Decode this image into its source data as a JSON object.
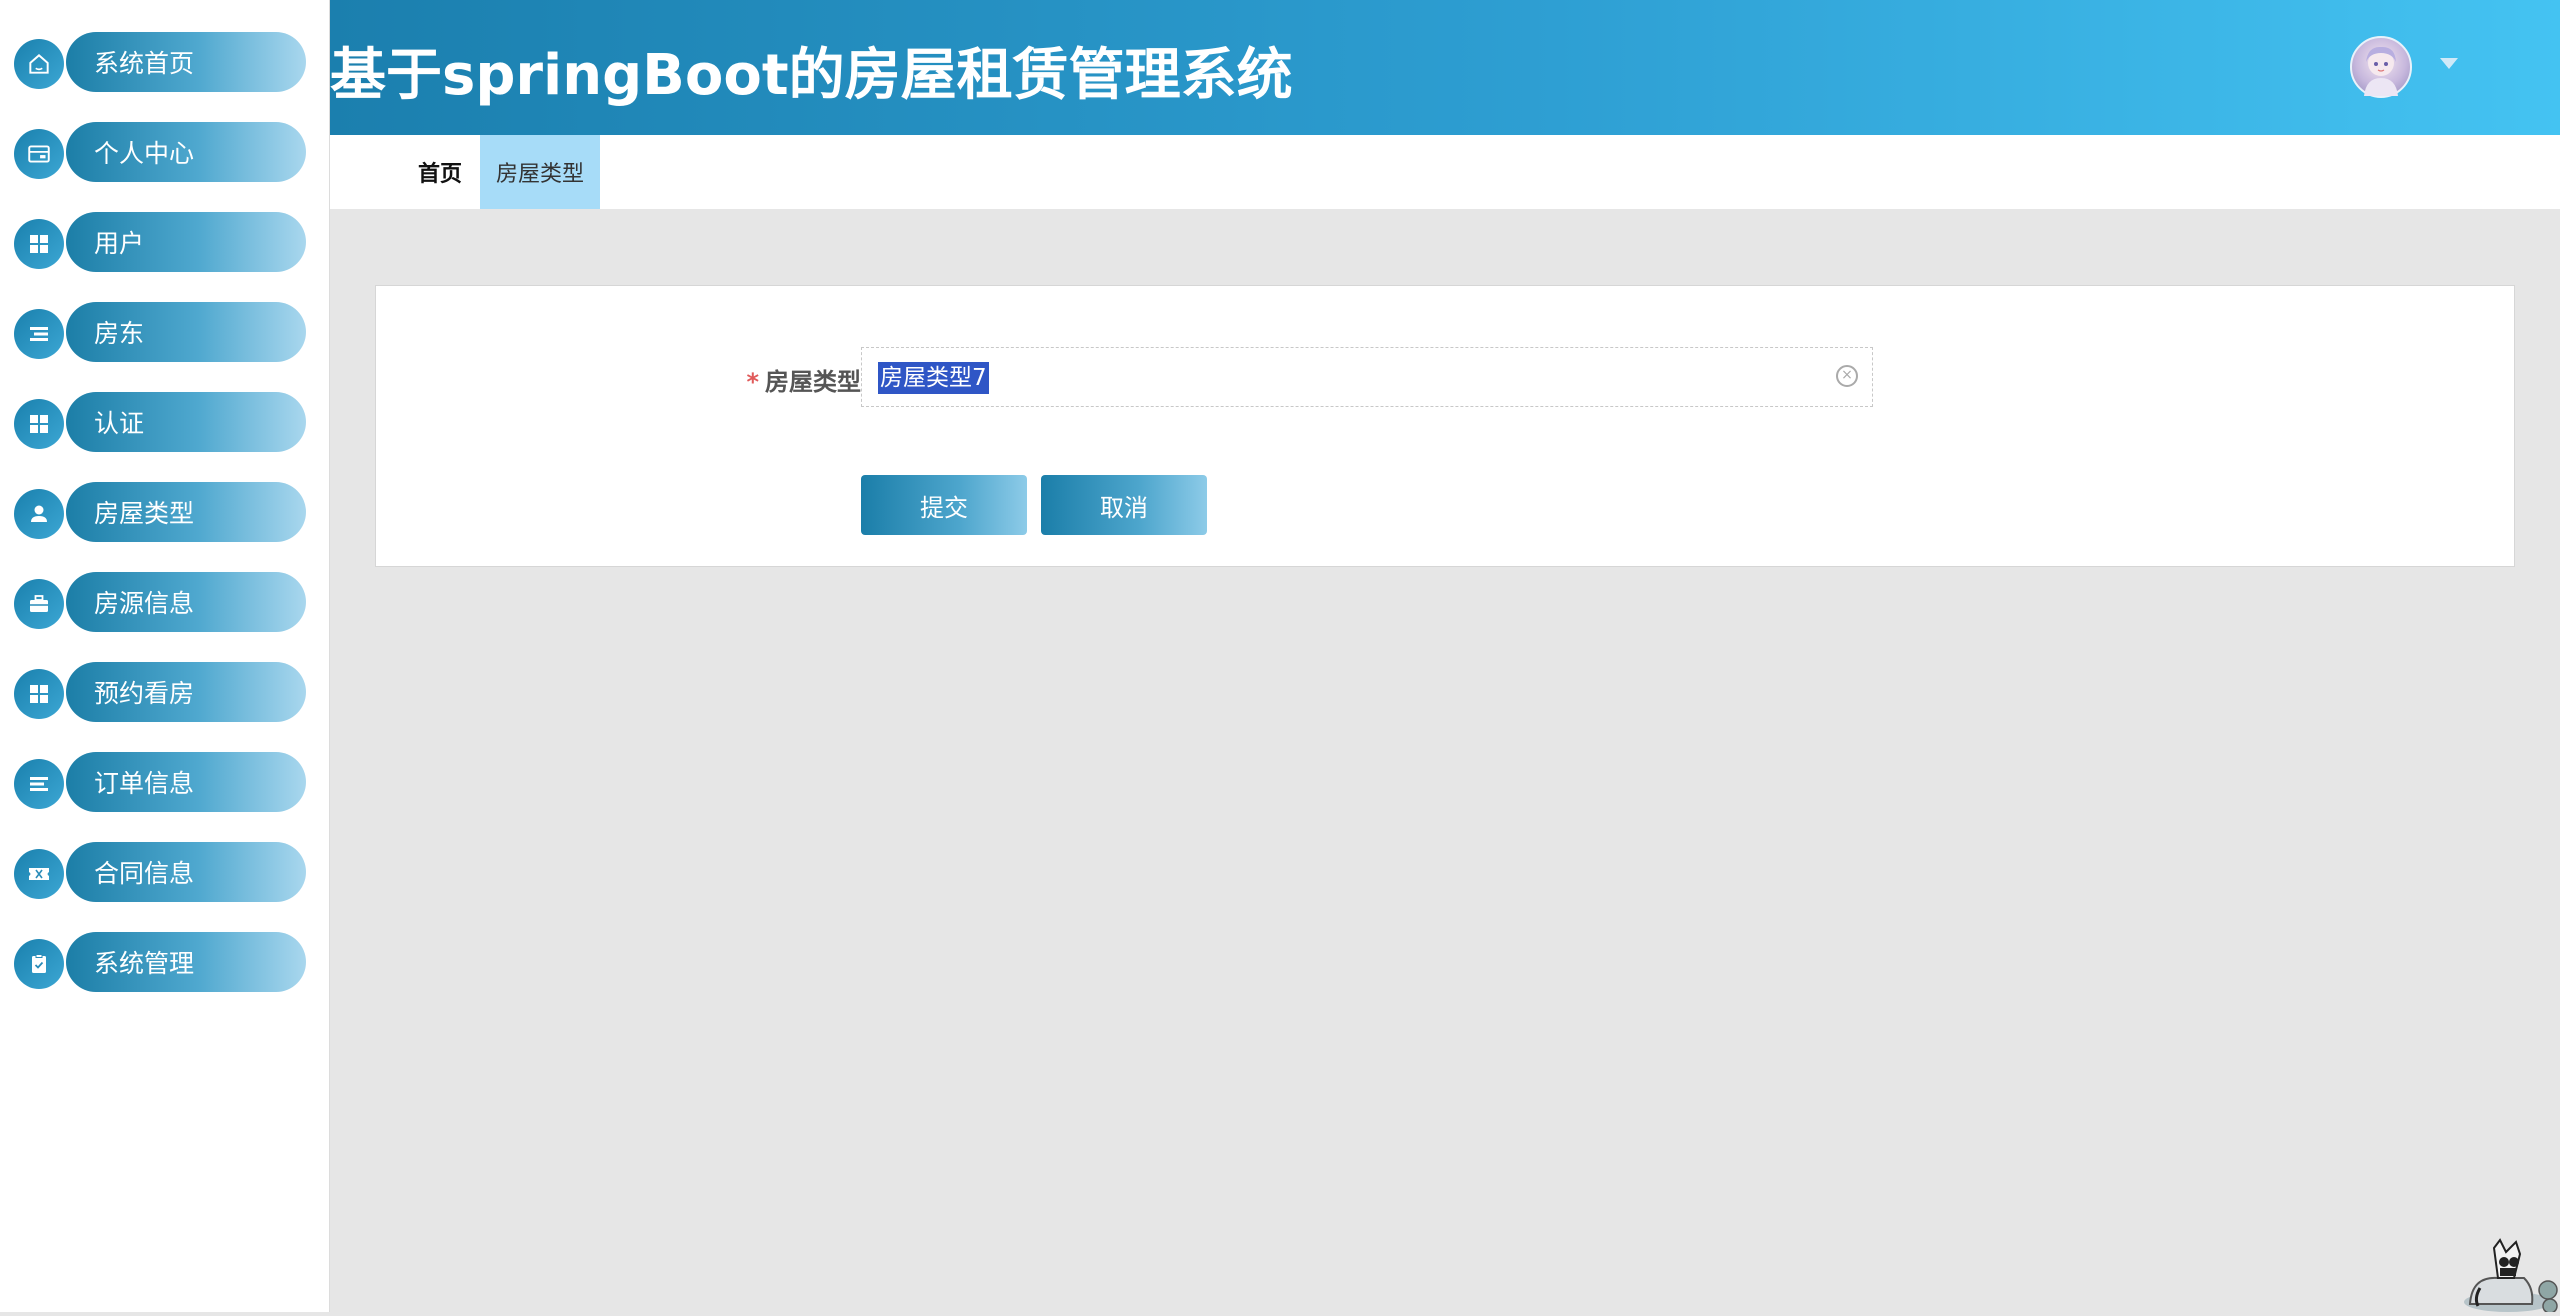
{
  "app": {
    "title": "基于springBoot的房屋租赁管理系统"
  },
  "sidebar": {
    "items": [
      {
        "label": "系统首页",
        "icon": "home-icon"
      },
      {
        "label": "个人中心",
        "icon": "id-card-icon"
      },
      {
        "label": "用户",
        "icon": "grid-icon"
      },
      {
        "label": "房东",
        "icon": "list-icon"
      },
      {
        "label": "认证",
        "icon": "grid-icon"
      },
      {
        "label": "房屋类型",
        "icon": "user-icon"
      },
      {
        "label": "房源信息",
        "icon": "briefcase-icon"
      },
      {
        "label": "预约看房",
        "icon": "grid-icon"
      },
      {
        "label": "订单信息",
        "icon": "list-icon"
      },
      {
        "label": "合同信息",
        "icon": "ticket-icon"
      },
      {
        "label": "系统管理",
        "icon": "clipboard-icon"
      }
    ]
  },
  "header": {
    "avatar_icon": "avatar-icon",
    "caret_icon": "caret-down-icon"
  },
  "tabs": {
    "home": "首页",
    "active": "房屋类型"
  },
  "form": {
    "required_mark": "*",
    "field_label": "房屋类型",
    "field_value": "房屋类型7",
    "clear_icon": "clear-circle-icon",
    "submit_label": "提交",
    "cancel_label": "取消"
  },
  "colors": {
    "header_start": "#1b7fae",
    "header_end": "#44c3f2",
    "active_tab": "#a7dcf8",
    "button_start": "#1b7ea9",
    "selection": "#2f56c6",
    "required": "#e05a5a"
  }
}
